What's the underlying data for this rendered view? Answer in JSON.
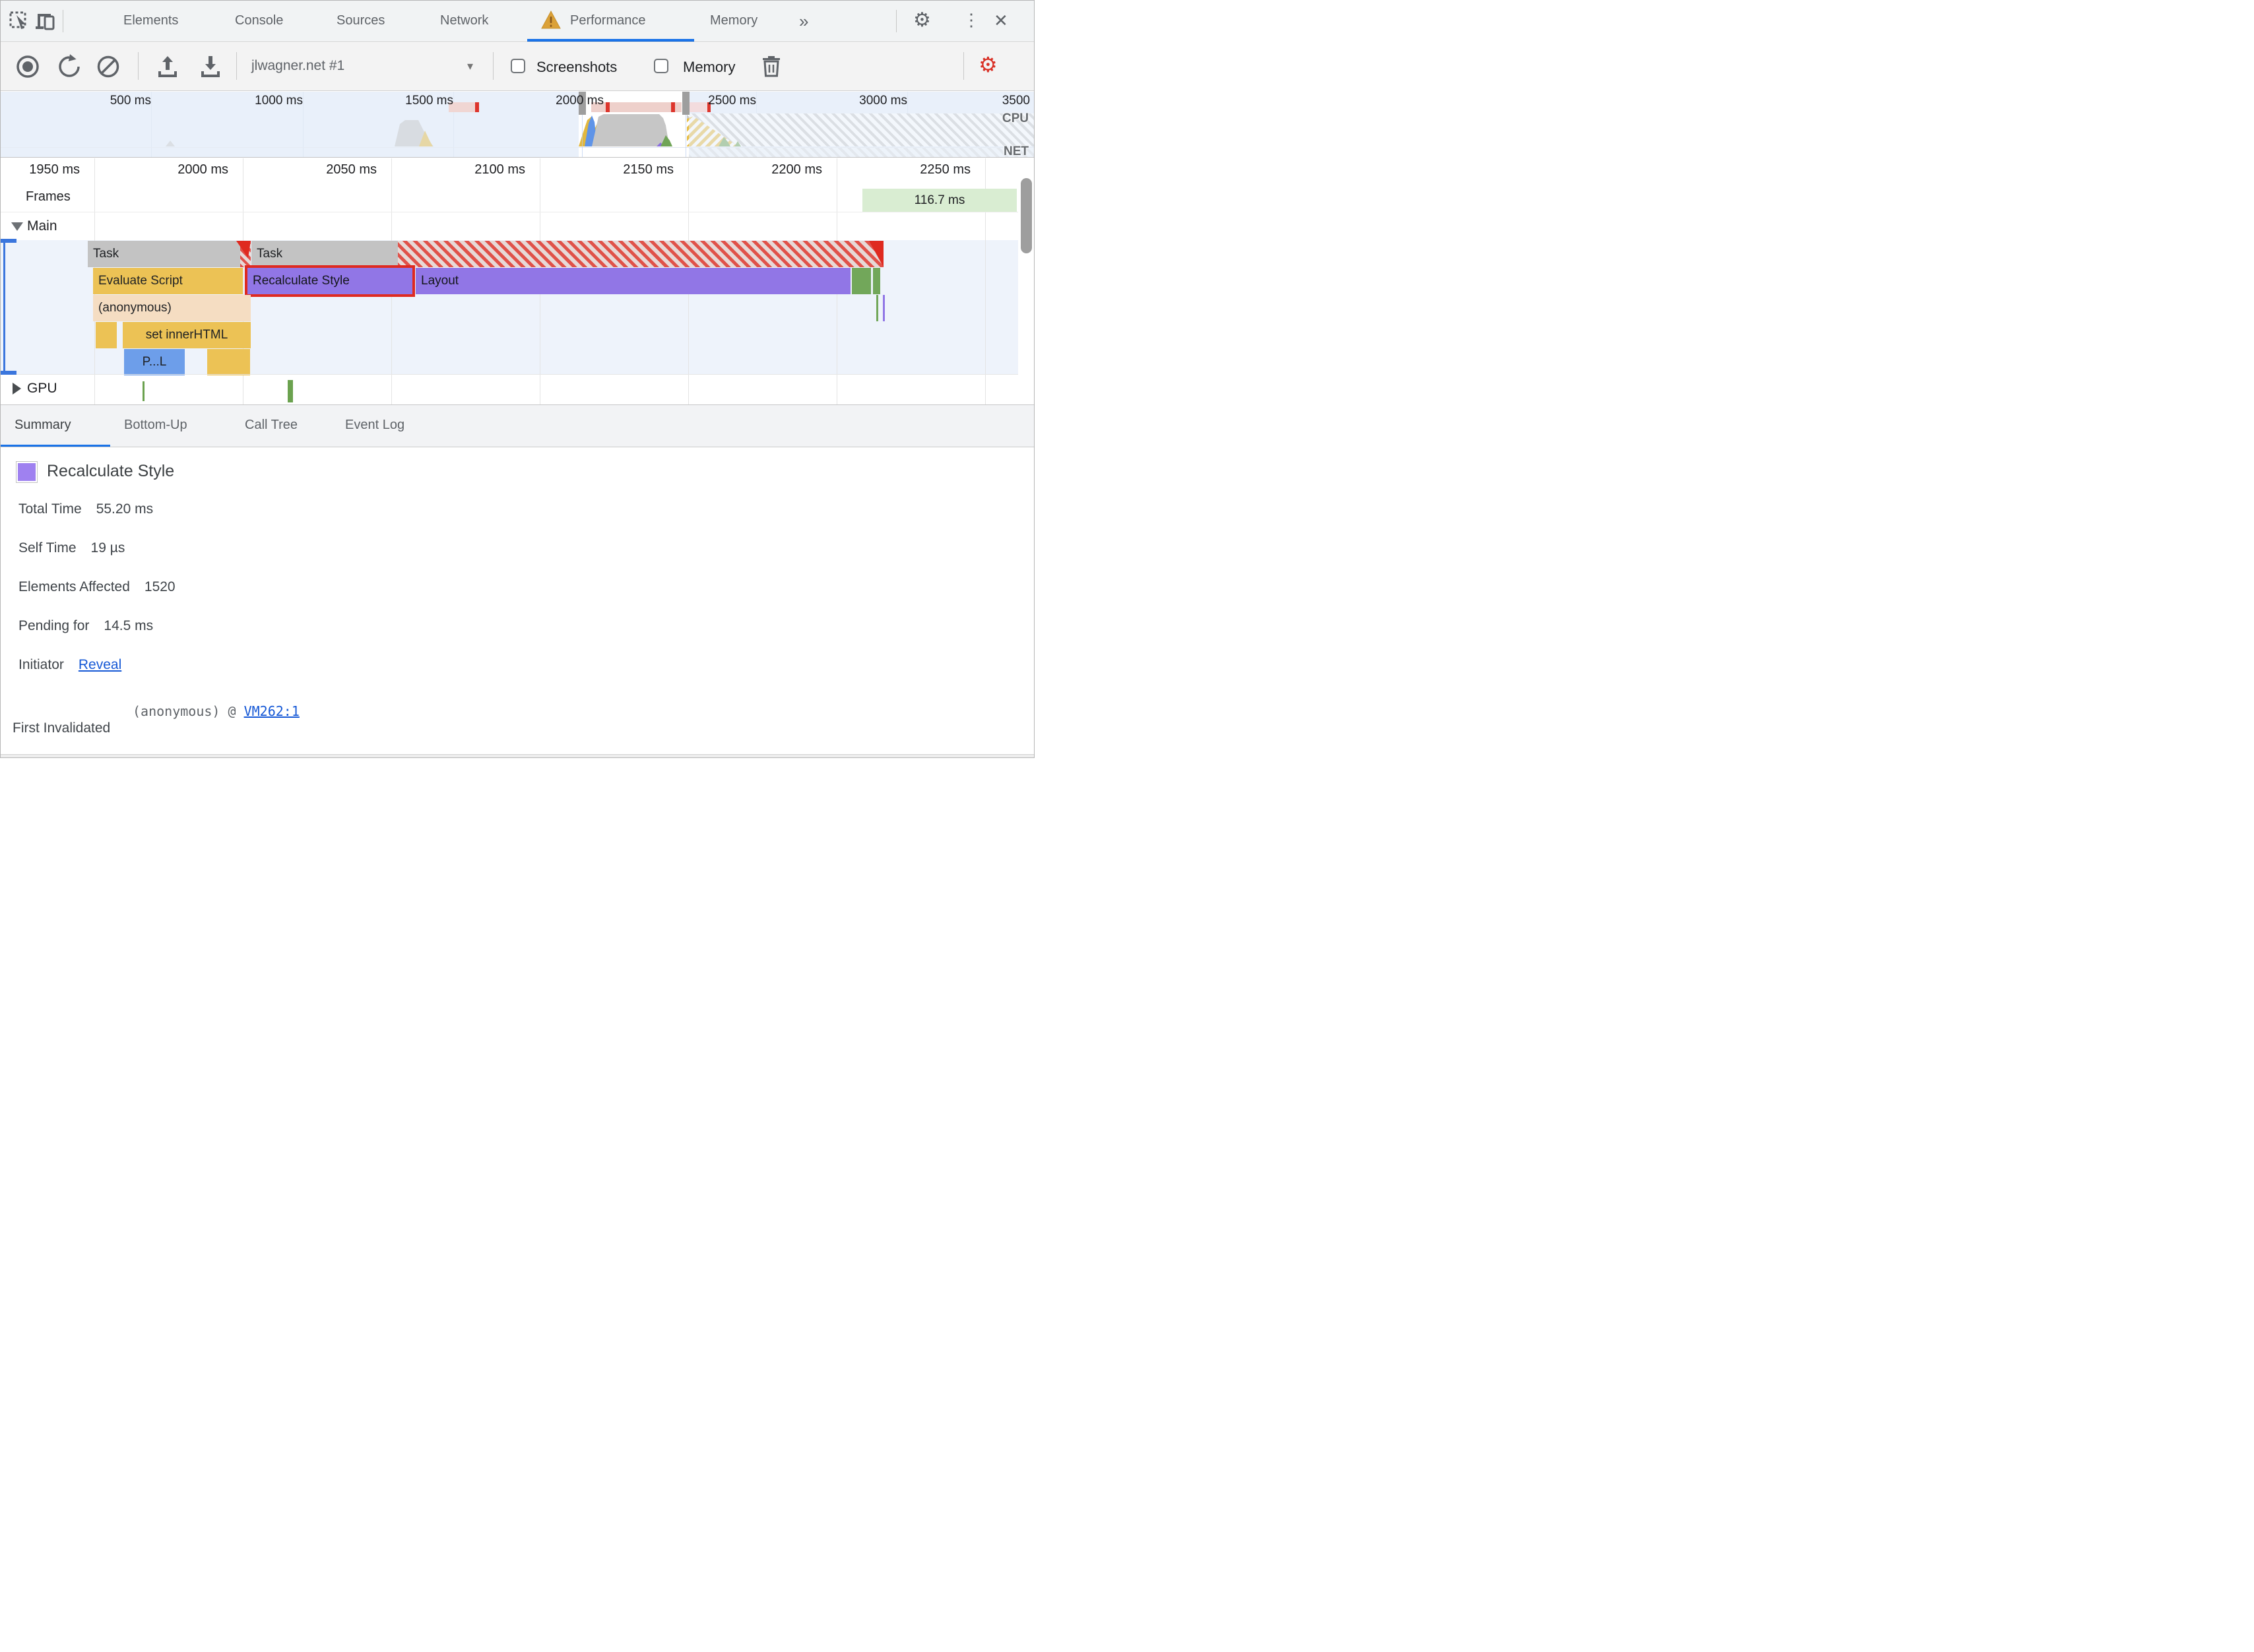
{
  "tabbar": {
    "tabs": [
      "Elements",
      "Console",
      "Sources",
      "Network",
      "Performance",
      "Memory"
    ],
    "overflow": "»"
  },
  "toolbar": {
    "session": "jlwagner.net #1",
    "screenshots_label": "Screenshots",
    "memory_label": "Memory"
  },
  "overview": {
    "ticks": [
      "500 ms",
      "1000 ms",
      "1500 ms",
      "2000 ms",
      "2500 ms",
      "3000 ms",
      "3500"
    ],
    "cpu_label": "CPU",
    "net_label": "NET"
  },
  "flame": {
    "ruler": [
      "1950 ms",
      "2000 ms",
      "2050 ms",
      "2100 ms",
      "2150 ms",
      "2200 ms",
      "2250 ms"
    ],
    "frames_label": "Frames",
    "frame_badge": "116.7 ms",
    "main_label": "Main",
    "gpu_label": "GPU",
    "bars": {
      "task1": "Task",
      "task2": "Task",
      "evaluate": "Evaluate Script",
      "recalc": "Recalculate Style",
      "layout": "Layout",
      "anonymous": "(anonymous)",
      "inner_html": "set innerHTML",
      "parse": "P...L"
    }
  },
  "bottom_tabs": [
    "Summary",
    "Bottom-Up",
    "Call Tree",
    "Event Log"
  ],
  "summary": {
    "title": "Recalculate Style",
    "rows": [
      {
        "label": "Total Time",
        "value": "55.20 ms"
      },
      {
        "label": "Self Time",
        "value": "19 µs"
      },
      {
        "label": "Elements Affected",
        "value": "1520"
      },
      {
        "label": "Pending for",
        "value": "14.5 ms"
      }
    ],
    "initiator_label": "Initiator",
    "initiator_link": "Reveal",
    "first_invalidated_label": "First Invalidated",
    "first_invalidated_value": "(anonymous) @ ",
    "first_invalidated_link": "VM262:1"
  },
  "icons": {
    "gear": "⚙",
    "more": "⋮",
    "close": "✕",
    "dropdown": "▾"
  },
  "palette": {
    "accent_blue": "#1a73e8",
    "scripting_yellow": "#ecc255",
    "rendering_purple": "#9176e6",
    "painting_green": "#72a75a",
    "loading_blue": "#6d9eea",
    "task_gray": "#c3c3c3",
    "long_task_red": "#df2a20",
    "warning_orange": "#dba138",
    "settings_alert_red": "#d93025"
  }
}
